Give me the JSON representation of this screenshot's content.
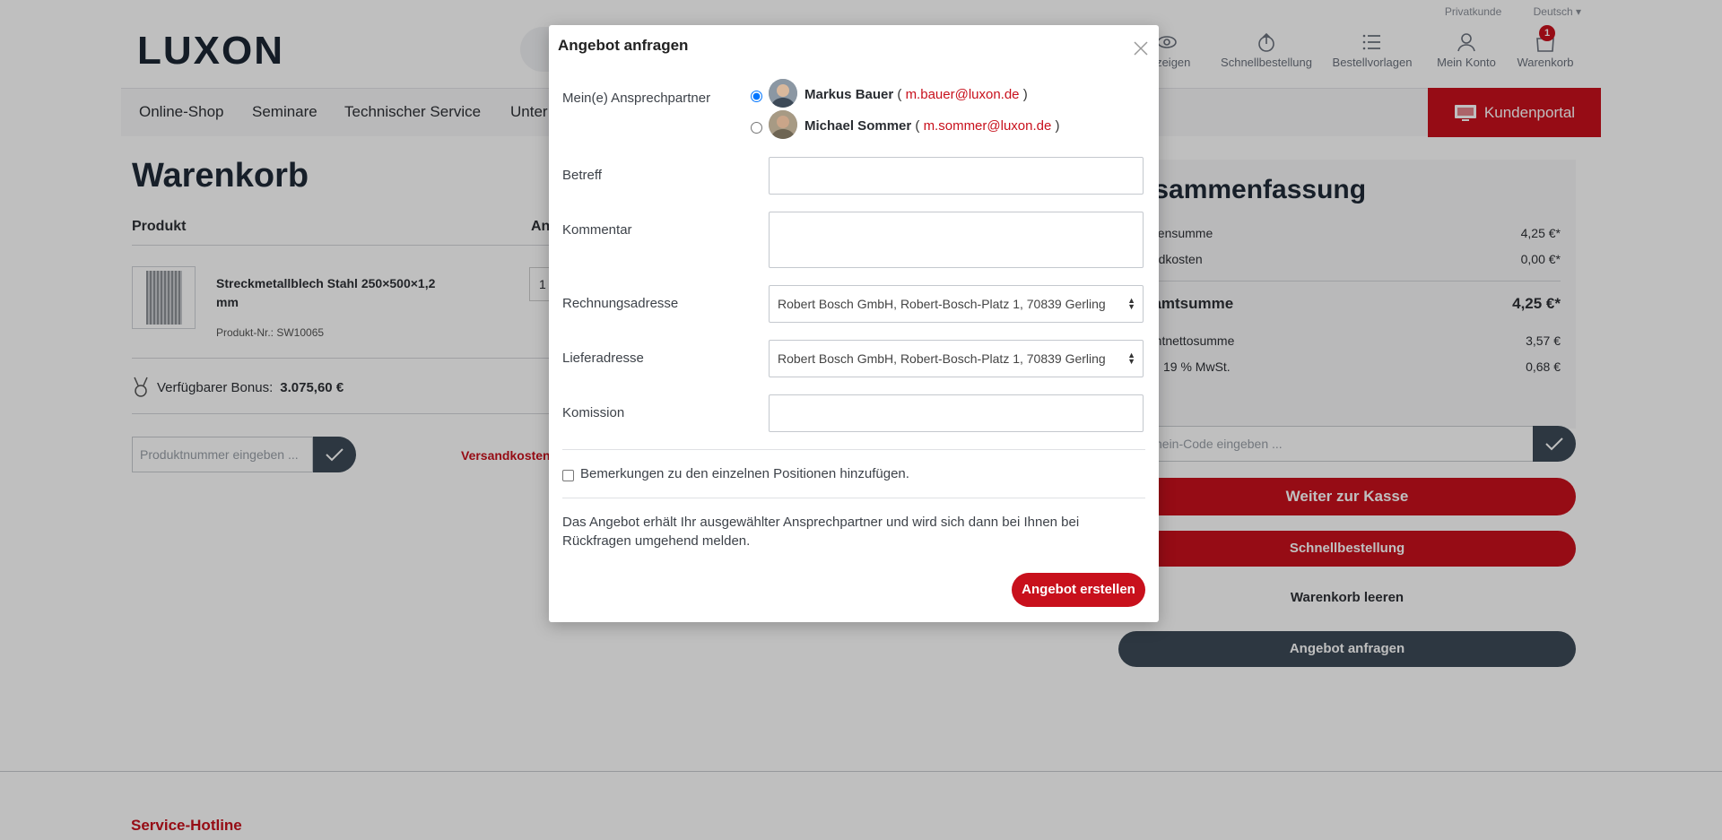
{
  "topbar": {
    "customer_type": "Privatkunde",
    "language": "Deutsch"
  },
  "header": {
    "logo": "LUXON",
    "icons": [
      {
        "label": "anzeigen",
        "icon": "eye-icon"
      },
      {
        "label": "Schnellbestellung",
        "icon": "quick-order-icon"
      },
      {
        "label": "Bestellvorlagen",
        "icon": "list-icon"
      },
      {
        "label": "Mein Konto",
        "icon": "user-icon"
      },
      {
        "label": "Warenkorb",
        "icon": "bag-icon",
        "badge": "1"
      }
    ]
  },
  "nav": {
    "items": [
      "Online-Shop",
      "Seminare",
      "Technischer Service",
      "Unter"
    ],
    "portal_label": "Kundenportal"
  },
  "cart": {
    "title": "Warenkorb",
    "col_product": "Produkt",
    "col_amount": "An",
    "product": {
      "name": "Streckmetallblech Stahl 250×500×1,2 mm",
      "number": "Produkt-Nr.: SW10065",
      "quantity": "1"
    },
    "bonus_label": "Verfügbarer Bonus:",
    "bonus_value": "3.075,60 €",
    "product_number_placeholder": "Produktnummer eingeben ...",
    "shipping_link": "Versandkosten"
  },
  "summary": {
    "title": "usammenfassung",
    "rows": [
      {
        "label": "chensumme",
        "value": "4,25 €*"
      },
      {
        "label": "andkosten",
        "value": "0,00 €*"
      },
      {
        "label": "samtsumme",
        "value": "4,25 €*"
      },
      {
        "label": "amtnettosumme",
        "value": "3,57 €"
      },
      {
        "label": "19 % MwSt.",
        "value": "0,68 €"
      }
    ],
    "voucher_placeholder": "chein-Code eingeben ...",
    "checkout": "Weiter zur Kasse",
    "quick_order": "Schnellbestellung",
    "clear_cart": "Warenkorb leeren",
    "request_quote": "Angebot anfragen"
  },
  "footer": {
    "hotline": "Service-Hotline"
  },
  "modal": {
    "title": "Angebot anfragen",
    "contact_label": "Mein(e) Ansprechpartner",
    "contacts": [
      {
        "name": "Markus Bauer",
        "email": "m.bauer@luxon.de",
        "selected": true
      },
      {
        "name": "Michael Sommer",
        "email": "m.sommer@luxon.de",
        "selected": false
      }
    ],
    "subject_label": "Betreff",
    "subject_value": "",
    "comment_label": "Kommentar",
    "comment_value": "",
    "billing_label": "Rechnungsadresse",
    "billing_value": "Robert Bosch GmbH, Robert-Bosch-Platz 1, 70839 Gerling",
    "delivery_label": "Lieferadresse",
    "delivery_value": "Robert Bosch GmbH, Robert-Bosch-Platz 1, 70839 Gerling",
    "commission_label": "Komission",
    "commission_value": "",
    "remarks_label": "Bemerkungen zu den einzelnen Positionen hinzufügen.",
    "note": "Das Angebot erhält Ihr ausgewählter Ansprechpartner und wird sich dann bei Ihnen bei Rückfragen umgehend melden.",
    "submit": "Angebot erstellen"
  }
}
